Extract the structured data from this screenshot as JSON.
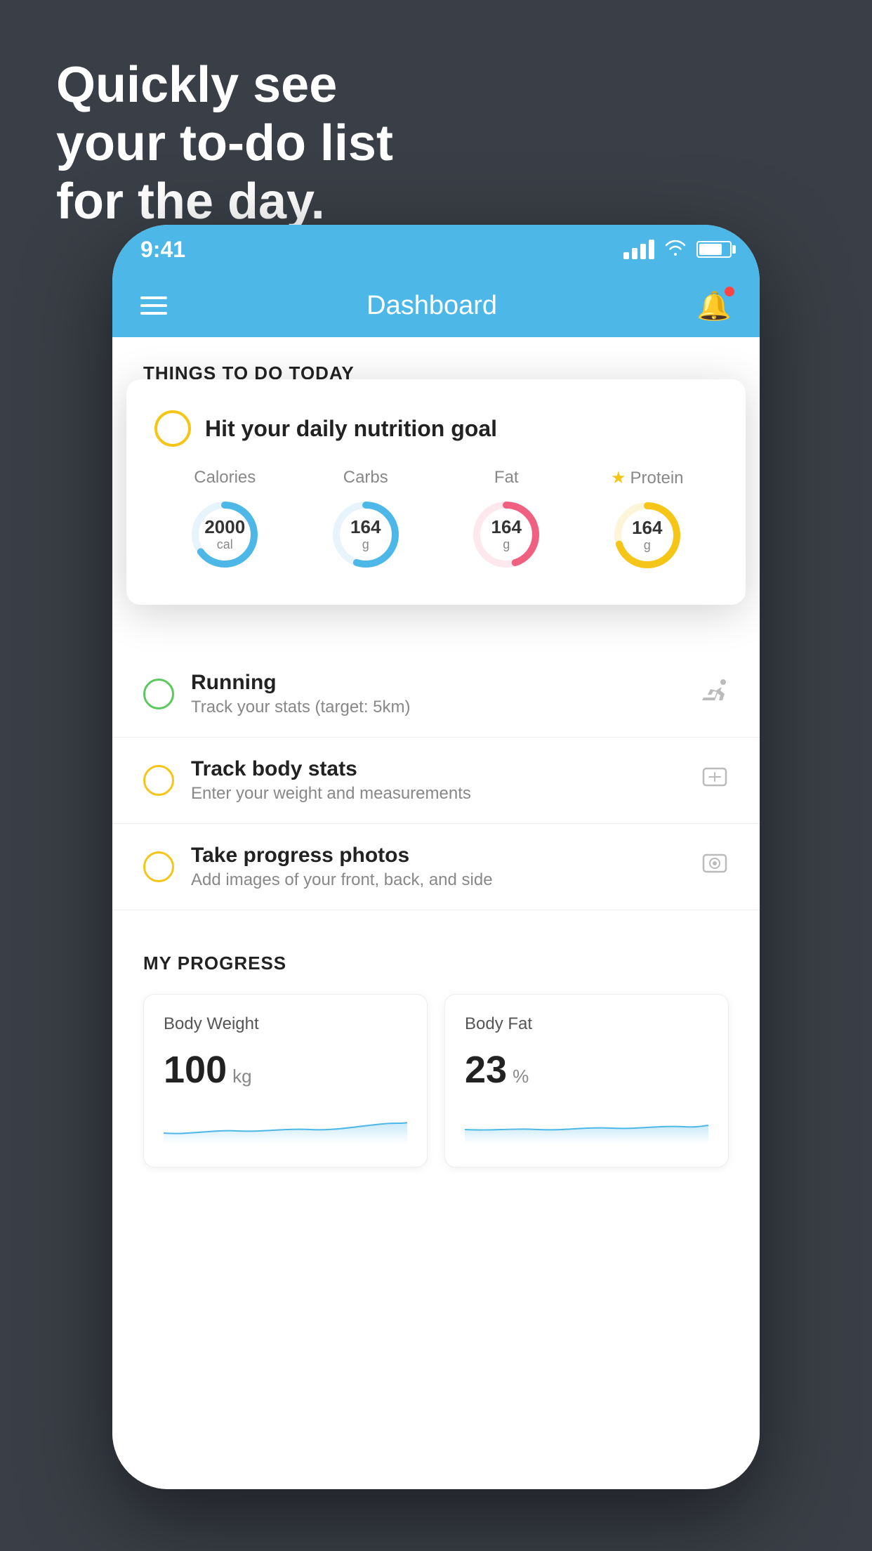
{
  "hero": {
    "line1": "Quickly see",
    "line2": "your to-do list",
    "line3": "for the day."
  },
  "status_bar": {
    "time": "9:41"
  },
  "nav": {
    "title": "Dashboard"
  },
  "section_title": "THINGS TO DO TODAY",
  "floating_card": {
    "title": "Hit your daily nutrition goal",
    "stats": [
      {
        "label": "Calories",
        "value": "2000",
        "unit": "cal",
        "color": "#4db8e8",
        "starred": false,
        "percent": 65
      },
      {
        "label": "Carbs",
        "value": "164",
        "unit": "g",
        "color": "#4db8e8",
        "starred": false,
        "percent": 55
      },
      {
        "label": "Fat",
        "value": "164",
        "unit": "g",
        "color": "#f06080",
        "starred": false,
        "percent": 45
      },
      {
        "label": "Protein",
        "value": "164",
        "unit": "g",
        "color": "#f5c518",
        "starred": true,
        "percent": 70
      }
    ]
  },
  "todo_items": [
    {
      "title": "Running",
      "subtitle": "Track your stats (target: 5km)",
      "circle_color": "green",
      "icon": "👟"
    },
    {
      "title": "Track body stats",
      "subtitle": "Enter your weight and measurements",
      "circle_color": "yellow",
      "icon": "⚖"
    },
    {
      "title": "Take progress photos",
      "subtitle": "Add images of your front, back, and side",
      "circle_color": "yellow",
      "icon": "🪪"
    }
  ],
  "progress": {
    "header": "MY PROGRESS",
    "cards": [
      {
        "title": "Body Weight",
        "value": "100",
        "unit": "kg"
      },
      {
        "title": "Body Fat",
        "value": "23",
        "unit": "%"
      }
    ]
  }
}
